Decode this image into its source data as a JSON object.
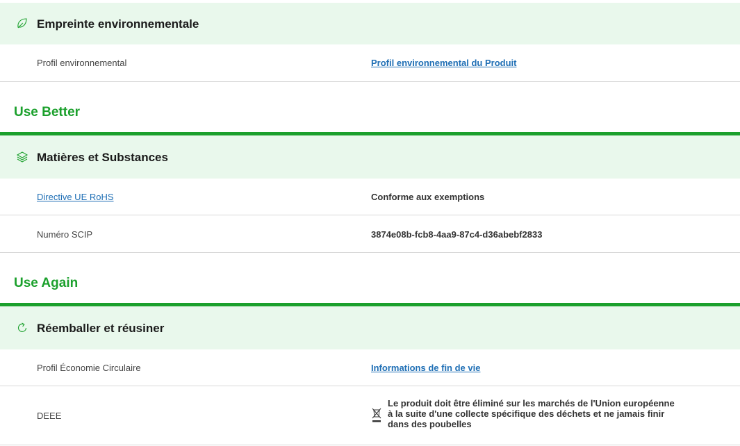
{
  "sections": {
    "environment": {
      "icon": "leaf-icon",
      "title": "Empreinte environnementale",
      "rows": [
        {
          "label": "Profil environnemental",
          "value": "Profil environnemental du Produit"
        }
      ]
    },
    "use_better": {
      "group_title": "Use Better",
      "icon": "layers-icon",
      "title": "Matières et Substances",
      "rows": [
        {
          "label": "Directive UE RoHS",
          "value": "Conforme aux exemptions"
        },
        {
          "label": "Numéro SCIP",
          "value": "3874e08b-fcb8-4aa9-87c4-d36abebf2833"
        }
      ]
    },
    "use_again": {
      "group_title": "Use Again",
      "icon": "refresh-icon",
      "title": "Réemballer et réusiner",
      "rows": [
        {
          "label": "Profil Économie Circulaire",
          "value": "Informations de fin de vie"
        },
        {
          "label": "DEEE",
          "icon": "crossed-bin-icon",
          "value": "Le produit doit être éliminé sur les marchés de l'Union européenne à la suite d'une collecte spécifique des déchets et ne jamais finir dans des poubelles"
        }
      ]
    }
  },
  "colors": {
    "accent_green": "#1ba02c",
    "header_bg": "#e9f8ec",
    "link_blue": "#1f6fb5",
    "divider": "#d8d8d8"
  }
}
